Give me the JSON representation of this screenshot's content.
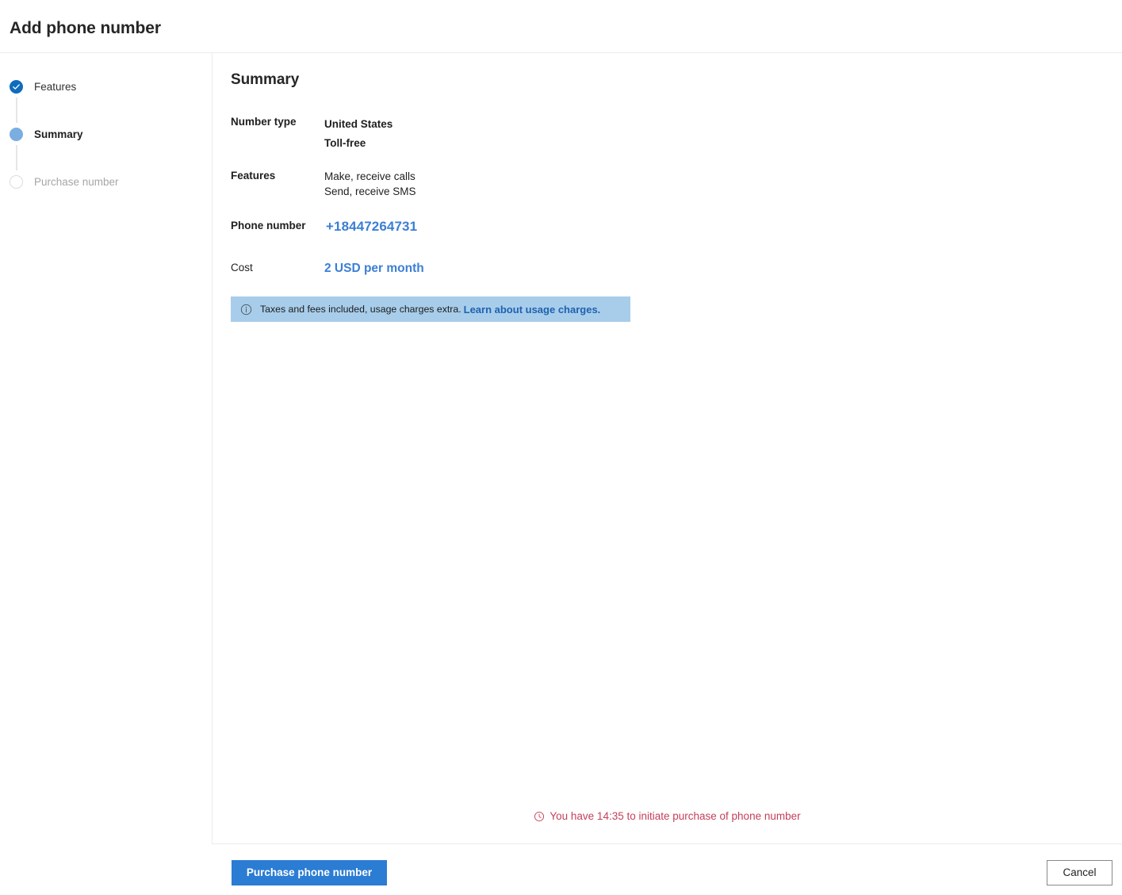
{
  "header": {
    "title": "Add phone number"
  },
  "stepper": {
    "steps": [
      {
        "label": "Features",
        "state": "completed",
        "icon": "check-icon"
      },
      {
        "label": "Summary",
        "state": "current",
        "icon": "filled-circle-icon"
      },
      {
        "label": "Purchase number",
        "state": "upcoming",
        "icon": "empty-circle-icon"
      }
    ]
  },
  "main": {
    "section_title": "Summary",
    "rows": {
      "number_type": {
        "label": "Number type",
        "value_line_1": "United States",
        "value_line_2": "Toll-free"
      },
      "features": {
        "label": "Features",
        "value_line_1": "Make, receive calls",
        "value_line_2": "Send, receive SMS"
      },
      "phone_number": {
        "label": "Phone number",
        "value": "+18447264731"
      },
      "cost": {
        "label": "Cost",
        "value": "2 USD per month"
      }
    },
    "info_banner": {
      "icon": "info-circle-icon",
      "text": "Taxes and fees included, usage charges extra.",
      "link_text": "Learn about usage charges.",
      "background_color": "#a8cdea",
      "link_color": "#1f62b0"
    },
    "timer": {
      "icon": "clock-icon",
      "text": "You have 14:35 to initiate purchase of phone number",
      "remaining": "14:35",
      "color": "#c4405a"
    }
  },
  "footer": {
    "primary_button": {
      "label": "Purchase phone number",
      "color": "#2b7cd3"
    },
    "secondary_button": {
      "label": "Cancel"
    }
  },
  "colors": {
    "accent": "#0f6cbd",
    "link_blue": "#3b7fd4",
    "divider": "#ebebeb",
    "current_step": "#7aaee0"
  }
}
